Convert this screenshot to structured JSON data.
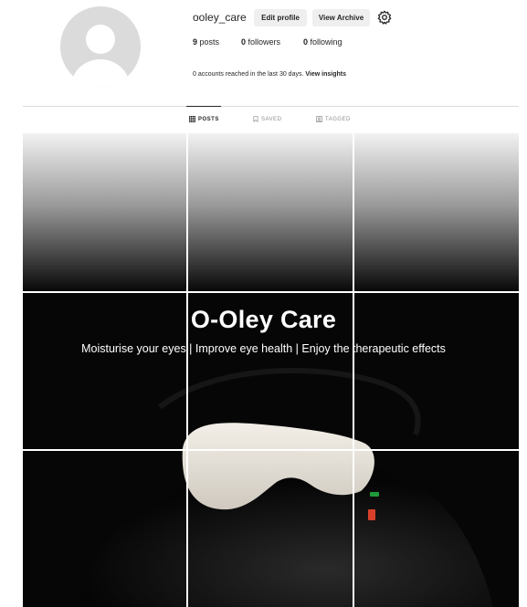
{
  "profile": {
    "username": "ooley_care",
    "edit_profile_label": "Edit profile",
    "view_archive_label": "View Archive",
    "stats": {
      "posts_count": "9",
      "posts_label": "posts",
      "followers_count": "0",
      "followers_label": "followers",
      "following_count": "0",
      "following_label": "following"
    },
    "reach_text": "0 accounts reached in the last 30 days.",
    "insights_link": "View insights"
  },
  "tabs": [
    {
      "label": "POSTS",
      "icon": "grid-icon",
      "active": true
    },
    {
      "label": "SAVED",
      "icon": "bookmark-icon",
      "active": false
    },
    {
      "label": "TAGGED",
      "icon": "tag-icon",
      "active": false
    }
  ],
  "banner": {
    "title": "O-Oley Care",
    "subtitle": "Moisturise your eyes | Improve eye health | Enjoy the therapeutic effects"
  },
  "colors": {
    "background": "#ffffff",
    "button": "#efefef",
    "divider": "#dbdbdb",
    "muted": "#8e8e8e"
  }
}
